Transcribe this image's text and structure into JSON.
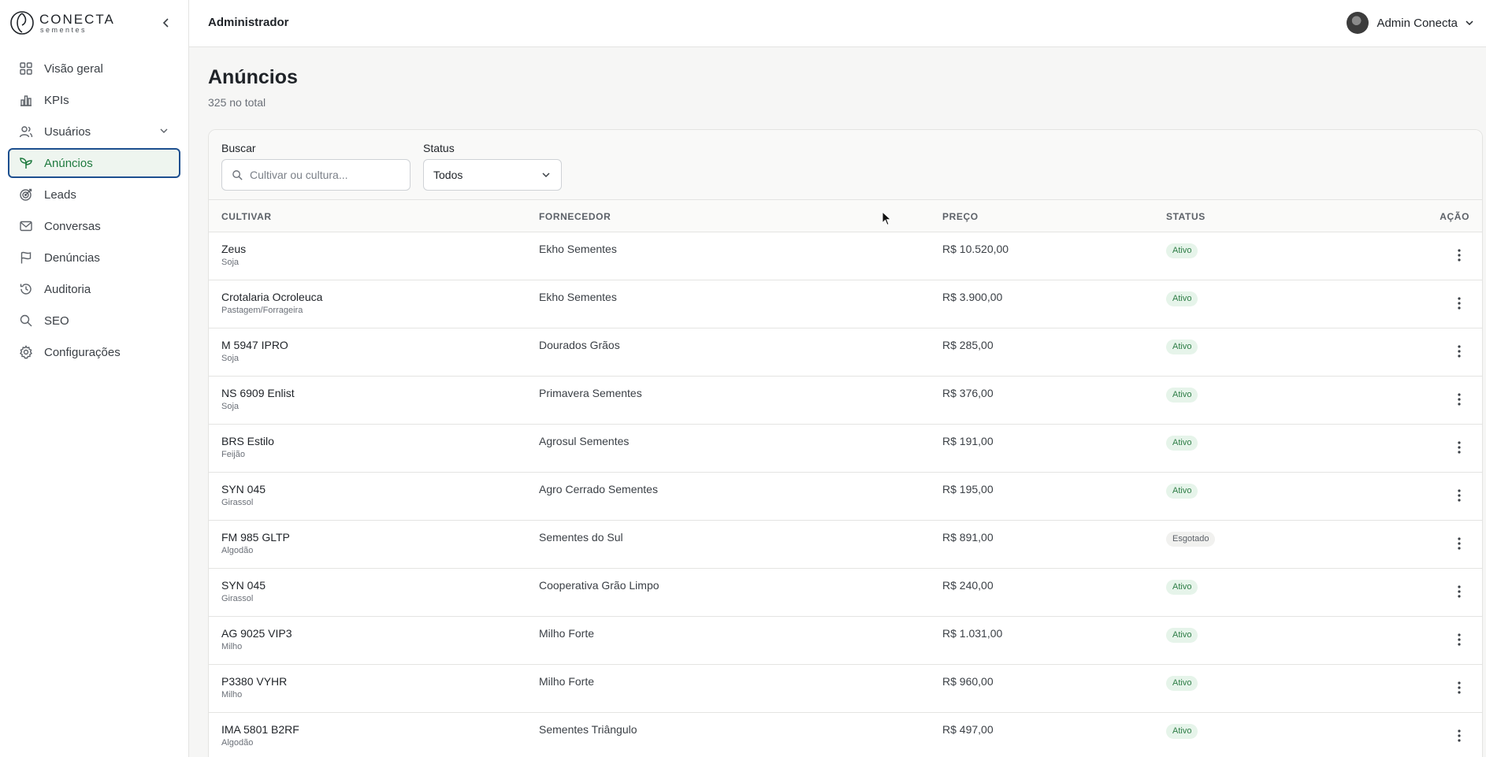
{
  "brand": {
    "name": "CONECTA",
    "sub": "sementes"
  },
  "sidebar": {
    "items": [
      {
        "label": "Visão geral",
        "icon": "dashboard-icon"
      },
      {
        "label": "KPIs",
        "icon": "bar-chart-icon"
      },
      {
        "label": "Usuários",
        "icon": "users-icon",
        "expandable": true
      },
      {
        "label": "Anúncios",
        "icon": "sprout-icon",
        "active": true
      },
      {
        "label": "Leads",
        "icon": "target-icon"
      },
      {
        "label": "Conversas",
        "icon": "mail-icon"
      },
      {
        "label": "Denúncias",
        "icon": "flag-icon"
      },
      {
        "label": "Auditoria",
        "icon": "history-icon"
      },
      {
        "label": "SEO",
        "icon": "search-icon"
      },
      {
        "label": "Configurações",
        "icon": "gear-icon"
      }
    ]
  },
  "header": {
    "title": "Administrador",
    "user_name": "Admin Conecta"
  },
  "page": {
    "title": "Anúncios",
    "subtitle": "325 no total"
  },
  "filters": {
    "search_label": "Buscar",
    "search_placeholder": "Cultivar ou cultura...",
    "search_value": "",
    "status_label": "Status",
    "status_value": "Todos"
  },
  "table": {
    "columns": [
      "CULTIVAR",
      "FORNECEDOR",
      "PREÇO",
      "STATUS",
      "AÇÃO"
    ],
    "rows": [
      {
        "name": "Zeus",
        "crop": "Soja",
        "supplier": "Ekho Sementes",
        "price": "R$ 10.520,00",
        "status": "Ativo"
      },
      {
        "name": "Crotalaria Ocroleuca",
        "crop": "Pastagem/Forrageira",
        "supplier": "Ekho Sementes",
        "price": "R$ 3.900,00",
        "status": "Ativo"
      },
      {
        "name": "M 5947 IPRO",
        "crop": "Soja",
        "supplier": "Dourados Grãos",
        "price": "R$ 285,00",
        "status": "Ativo"
      },
      {
        "name": "NS 6909 Enlist",
        "crop": "Soja",
        "supplier": "Primavera Sementes",
        "price": "R$ 376,00",
        "status": "Ativo"
      },
      {
        "name": "BRS Estilo",
        "crop": "Feijão",
        "supplier": "Agrosul Sementes",
        "price": "R$ 191,00",
        "status": "Ativo"
      },
      {
        "name": "SYN 045",
        "crop": "Girassol",
        "supplier": "Agro Cerrado Sementes",
        "price": "R$ 195,00",
        "status": "Ativo"
      },
      {
        "name": "FM 985 GLTP",
        "crop": "Algodão",
        "supplier": "Sementes do Sul",
        "price": "R$ 891,00",
        "status": "Esgotado"
      },
      {
        "name": "SYN 045",
        "crop": "Girassol",
        "supplier": "Cooperativa Grão Limpo",
        "price": "R$ 240,00",
        "status": "Ativo"
      },
      {
        "name": "AG 9025 VIP3",
        "crop": "Milho",
        "supplier": "Milho Forte",
        "price": "R$ 1.031,00",
        "status": "Ativo"
      },
      {
        "name": "P3380 VYHR",
        "crop": "Milho",
        "supplier": "Milho Forte",
        "price": "R$ 960,00",
        "status": "Ativo"
      },
      {
        "name": "IMA 5801 B2RF",
        "crop": "Algodão",
        "supplier": "Sementes Triângulo",
        "price": "R$ 497,00",
        "status": "Ativo"
      }
    ]
  },
  "colors": {
    "accent": "#1f7a3f",
    "active_border": "#1d4f8f",
    "badge_ativo_bg": "#e6f4ea",
    "badge_ativo_text": "#2e7d46"
  }
}
